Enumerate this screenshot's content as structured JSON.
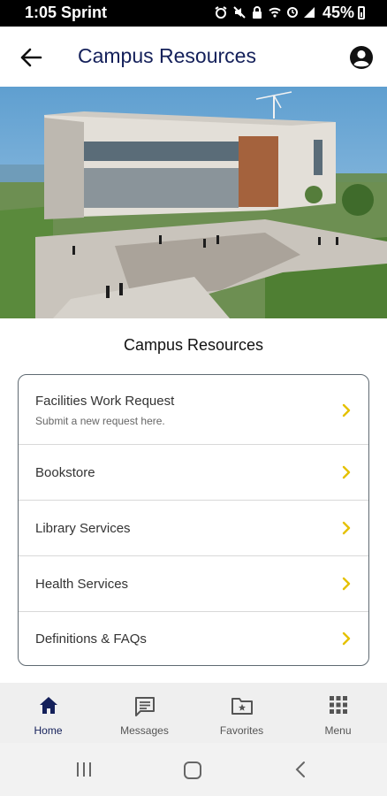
{
  "status": {
    "time": "1:05 Sprint",
    "battery": "45%"
  },
  "appbar": {
    "title": "Campus Resources"
  },
  "hero": {
    "alt": "Campus building photo"
  },
  "section": {
    "title": "Campus Resources"
  },
  "resources": [
    {
      "label": "Facilities Work Request",
      "sub": "Submit a new request here."
    },
    {
      "label": "Bookstore"
    },
    {
      "label": "Library Services"
    },
    {
      "label": "Health Services"
    },
    {
      "label": "Definitions & FAQs"
    }
  ],
  "nav": [
    {
      "label": "Home",
      "icon": "home-icon",
      "active": true
    },
    {
      "label": "Messages",
      "icon": "messages-icon"
    },
    {
      "label": "Favorites",
      "icon": "favorites-icon"
    },
    {
      "label": "Menu",
      "icon": "menu-grid-icon"
    }
  ],
  "colors": {
    "brand": "#14205a",
    "chevron": "#e5c100",
    "navbar": "#efefef"
  }
}
